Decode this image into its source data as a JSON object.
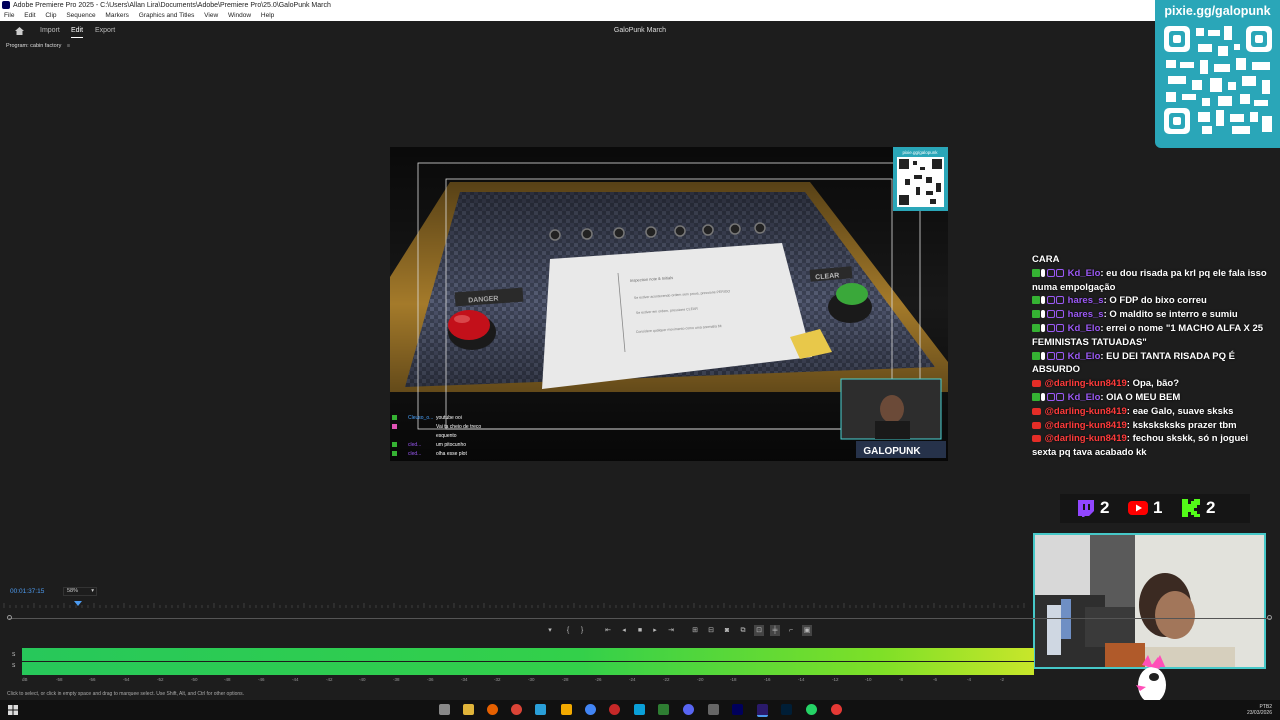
{
  "window": {
    "title": "Adobe Premiere Pro 2025 - C:\\Users\\Allan Lira\\Documents\\Adobe\\Premiere Pro\\25.0\\GaloPunk March"
  },
  "menu": [
    "File",
    "Edit",
    "Clip",
    "Sequence",
    "Markers",
    "Graphics and Titles",
    "View",
    "Window",
    "Help"
  ],
  "header": {
    "import": "Import",
    "edit": "Edit",
    "export": "Export",
    "project": "GaloPunk March"
  },
  "monitor": {
    "label": "Program: cabin factory",
    "menu_icon": "hamburger-icon"
  },
  "scene": {
    "paper_title": "Inspection note & Initials",
    "paper_line1": "Se estiver acontecendo ordem sem prova, pressione PERIGO",
    "paper_line2": "Se estiver em ordem, pressione CLEAR",
    "paper_line3": "Considere qualquer movimento como uma anomalia bit",
    "danger_label": "DANGER",
    "clear_label": "CLEAR",
    "qr_url_small": "pixie.gg/galopunk",
    "cam_name": "GALOPUNK",
    "mini_chat": [
      {
        "user": "Cleuso_o...",
        "text": "youtube ooi"
      },
      {
        "user": "",
        "text": "Vai ta cheio de treco"
      },
      {
        "user": "",
        "text": "esquento"
      },
      {
        "user": "cled...",
        "text": "um pitocunho"
      },
      {
        "user": "cled...",
        "text": "olha esse plot"
      }
    ]
  },
  "overlay": {
    "qr_url": "pixie.gg/galopunk",
    "chat": [
      {
        "platform": "none",
        "user": "",
        "text": "CARA"
      },
      {
        "platform": "twitch",
        "user": "Kd_Elo",
        "text": ": eu dou risada pa krl pq ele fala isso numa empolgação"
      },
      {
        "platform": "twitch",
        "user": "hares_s",
        "text": ": O FDP do bixo correu"
      },
      {
        "platform": "twitch",
        "user": "hares_s",
        "text": ": O maldito se interro e sumiu"
      },
      {
        "platform": "twitch",
        "user": "Kd_Elo",
        "text": ": errei o nome \"1 MACHO ALFA X 25 FEMINISTAS TATUADAS\""
      },
      {
        "platform": "twitch",
        "user": "Kd_Elo",
        "text": ": EU DEI TANTA RISADA PQ É ABSURDO"
      },
      {
        "platform": "youtube",
        "user": "@darling-kun8419",
        "text": ": Opa, bão?"
      },
      {
        "platform": "twitch",
        "user": "Kd_Elo",
        "text": ": OIA O MEU BEM"
      },
      {
        "platform": "youtube",
        "user": "@darling-kun8419",
        "text": ": eae Galo, suave sksks"
      },
      {
        "platform": "youtube",
        "user": "@darling-kun8419",
        "text": ": ksksksksks prazer tbm"
      },
      {
        "platform": "youtube",
        "user": "@darling-kun8419",
        "text": ": fechou skskk, só n joguei sexta pq tava acabado kk"
      }
    ],
    "counters": {
      "twitch": "2",
      "youtube": "1",
      "kick": "2"
    }
  },
  "timeline": {
    "timecode": "00:01:37:15",
    "zoom": "58%",
    "meter_labels": [
      "dB",
      "-58",
      "-56",
      "-54",
      "-52",
      "-50",
      "-48",
      "-46",
      "-44",
      "-42",
      "-40",
      "-38",
      "-36",
      "-34",
      "-32",
      "-30",
      "-28",
      "-26",
      "-24",
      "-22",
      "-20",
      "-18",
      "-16",
      "-14",
      "-12",
      "-10",
      "-8",
      "-6",
      "-4",
      "-2"
    ],
    "meter_side": [
      "S",
      "S"
    ],
    "status": "Click to select, or click in empty space and drag to marquee select. Use Shift, Alt, and Ctrl for other options."
  },
  "taskbar": {
    "time": "PTB2",
    "date": "23/03/2026"
  },
  "colors": {
    "accent_blue": "#4d9bf0",
    "teal": "#2aa6b8",
    "meter_green": "#27c85a"
  }
}
